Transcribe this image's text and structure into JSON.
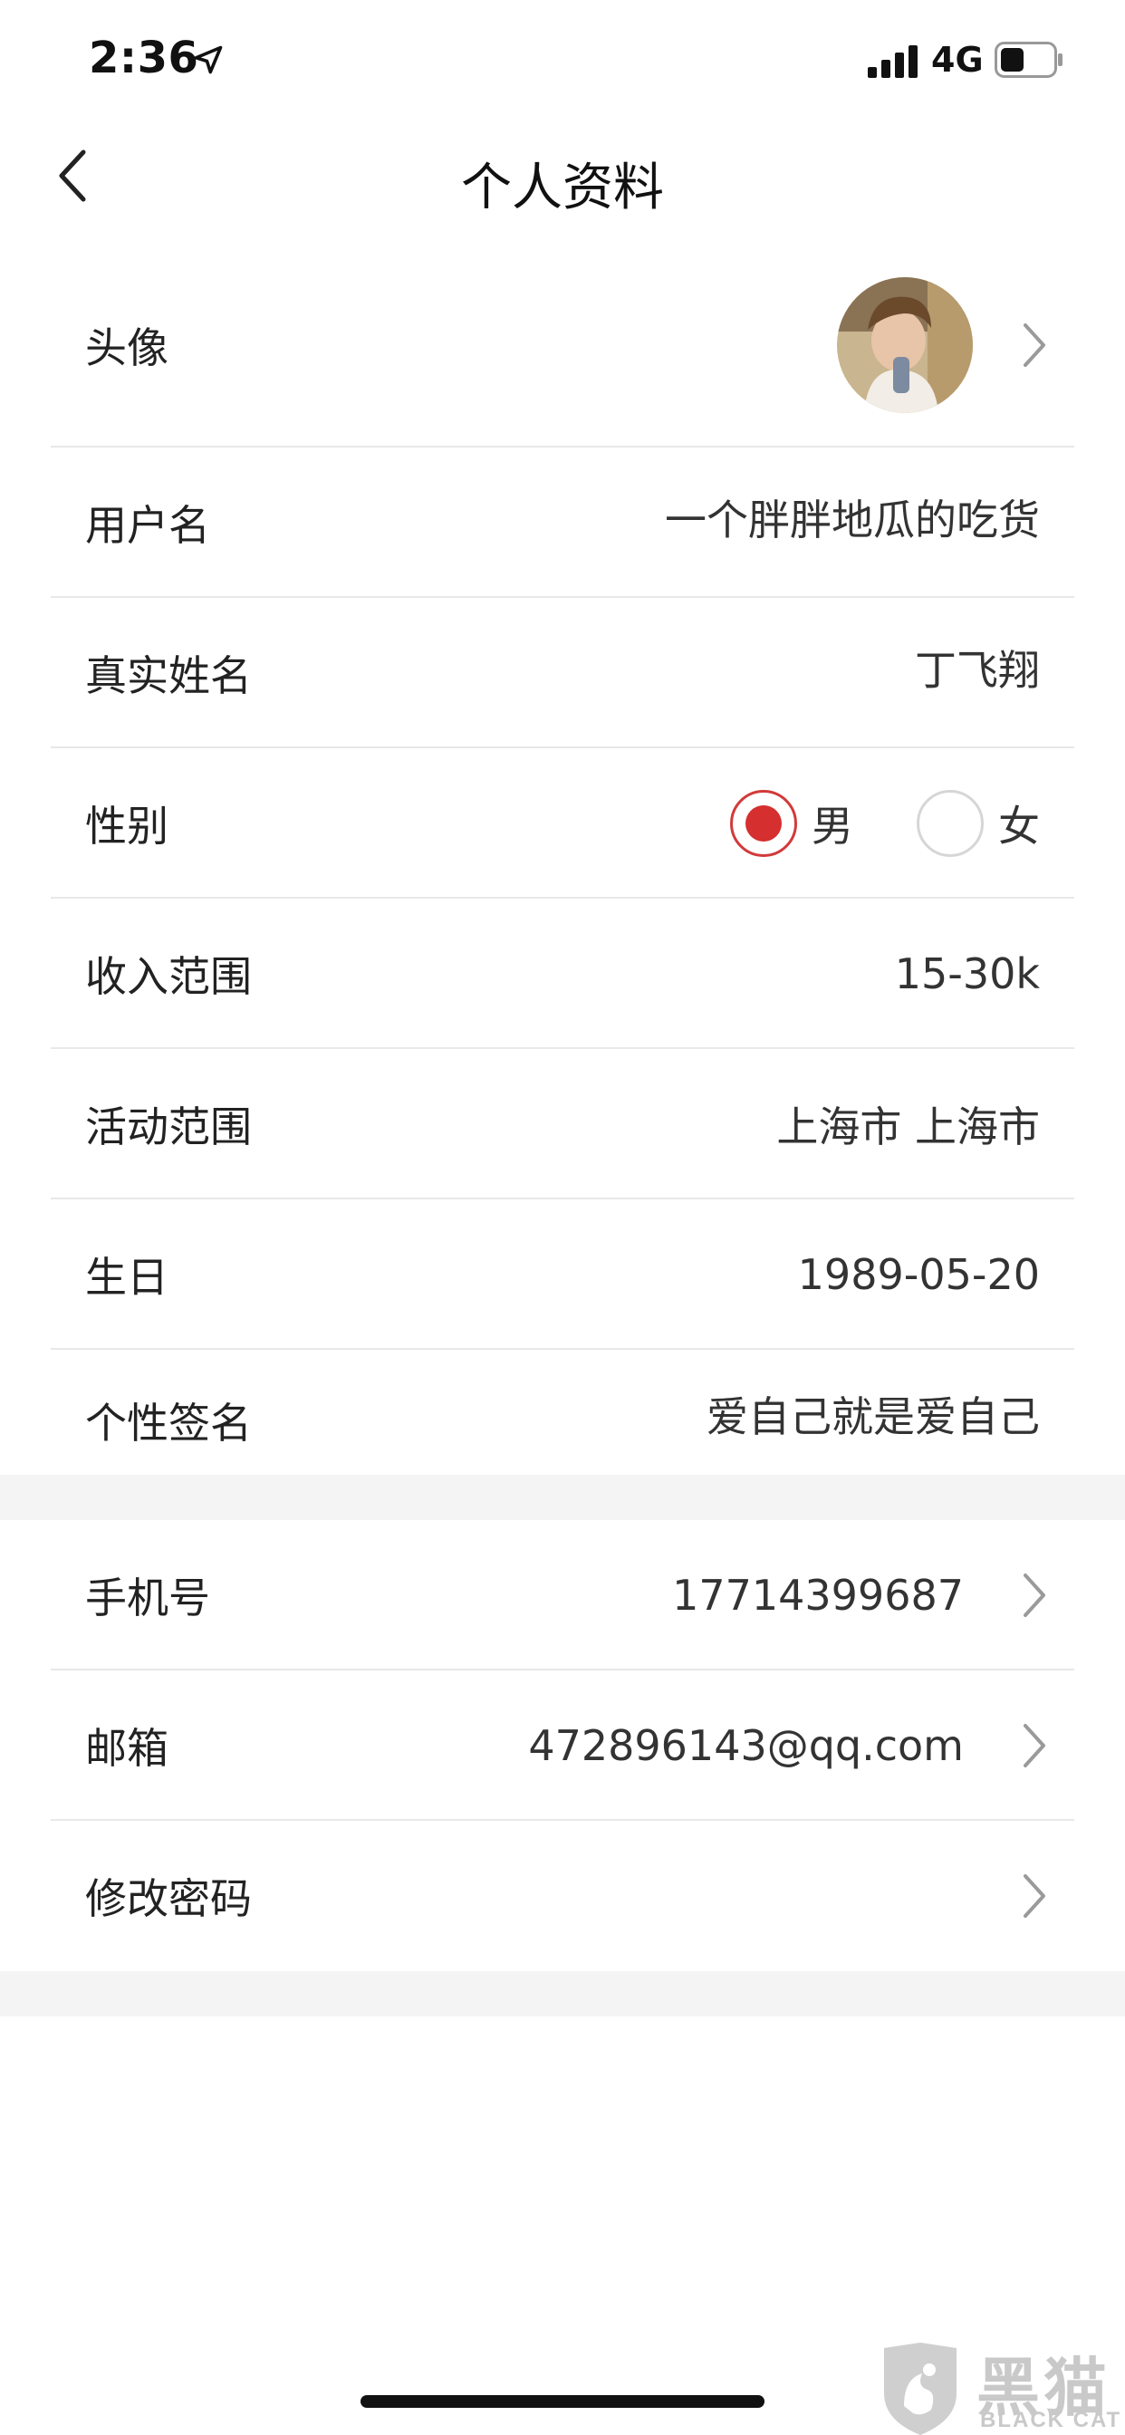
{
  "status_bar": {
    "time": "2:36",
    "network": "4G",
    "battery_level": 0.45,
    "icons": [
      "location-arrow-icon",
      "signal-bars-icon",
      "battery-icon"
    ]
  },
  "nav": {
    "title": "个人资料",
    "back_icon": "chevron-left-icon"
  },
  "profile": {
    "avatar_label": "头像",
    "username_label": "用户名",
    "username": "一个胖胖地瓜的吃货",
    "realname_label": "真实姓名",
    "realname": "丁飞翔",
    "gender_label": "性别",
    "gender_options": [
      "男",
      "女"
    ],
    "gender_selected": "男",
    "income_label": "收入范围",
    "income": "15-30k",
    "area_label": "活动范围",
    "area": "上海市 上海市",
    "birthday_label": "生日",
    "birthday": "1989-05-20",
    "signature_label": "个性签名",
    "signature": "爱自己就是爱自己"
  },
  "account": {
    "phone_label": "手机号",
    "phone": "17714399687",
    "email_label": "邮箱",
    "email": "472896143@qq.com",
    "password_label": "修改密码"
  },
  "watermark": {
    "cn": "黑猫",
    "en": "BLACK CAT"
  },
  "colors": {
    "accent_red": "#d52f2f",
    "divider": "#e8e8e8",
    "section_gap": "#f4f4f4"
  }
}
